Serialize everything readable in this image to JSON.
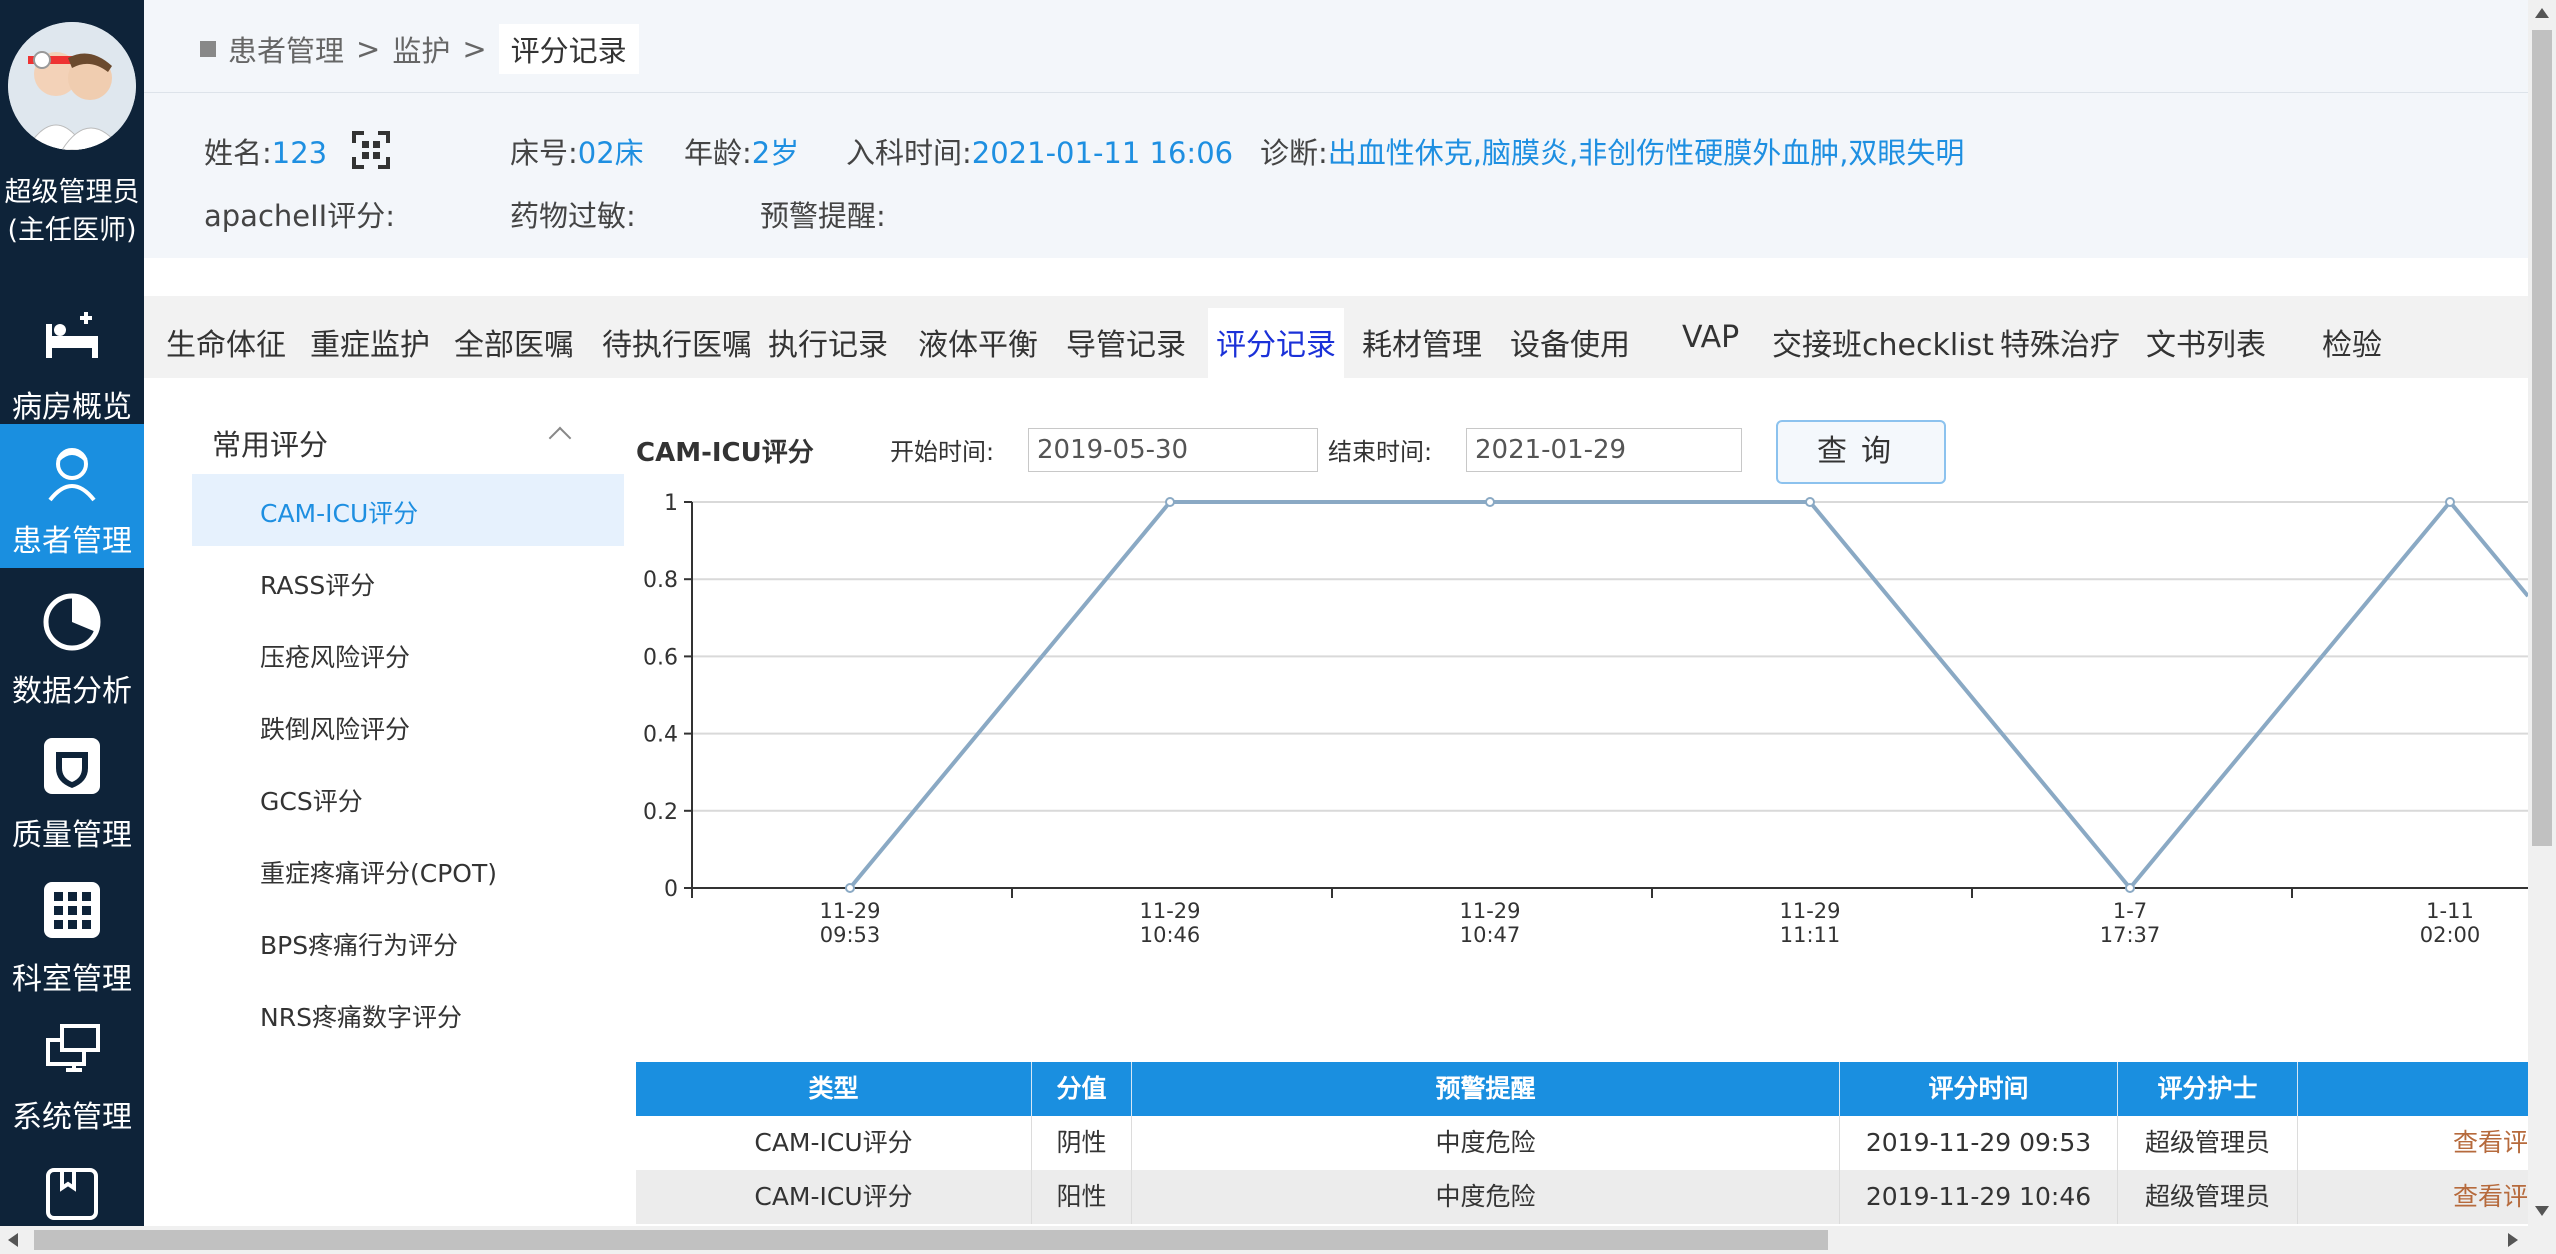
{
  "user": {
    "name": "超级管理员",
    "role": "(主任医师)"
  },
  "nav": [
    {
      "label": "病房概览",
      "icon": "bed-icon"
    },
    {
      "label": "患者管理",
      "icon": "patient-icon"
    },
    {
      "label": "数据分析",
      "icon": "pie-chart-icon"
    },
    {
      "label": "质量管理",
      "icon": "shield-icon"
    },
    {
      "label": "科室管理",
      "icon": "grid-icon"
    },
    {
      "label": "系统管理",
      "icon": "monitor-icon"
    },
    {
      "label": "",
      "icon": "archive-icon"
    }
  ],
  "breadcrumb": {
    "level1": "患者管理",
    "sep": ">",
    "level2": "监护",
    "current": "评分记录"
  },
  "patient": {
    "name_label": "姓名:",
    "name": "123",
    "bed_label": "床号:",
    "bed": "02床",
    "age_label": "年龄:",
    "age": "2岁",
    "admit_label": "入科时间:",
    "admit": "2021-01-11 16:06",
    "diag_label": "诊断:",
    "diag": "出血性休克,脑膜炎,非创伤性硬膜外血肿,双眼失明",
    "apache_label": "apacheII评分:",
    "allergy_label": "药物过敏:",
    "alert_label": "预警提醒:"
  },
  "tabs": [
    "生命体征",
    "重症监护",
    "全部医嘱",
    "待执行医嘱",
    "执行记录",
    "液体平衡",
    "导管记录",
    "评分记录",
    "耗材管理",
    "设备使用",
    "VAP",
    "交接班checklist",
    "特殊治疗",
    "文书列表",
    "检验"
  ],
  "menu": {
    "group": "常用评分",
    "items": [
      "CAM-ICU评分",
      "RASS评分",
      "压疮风险评分",
      "跌倒风险评分",
      "GCS评分",
      "重症疼痛评分(CPOT)",
      "BPS疼痛行为评分",
      "NRS疼痛数字评分"
    ]
  },
  "query": {
    "title": "CAM-ICU评分",
    "start_label": "开始时间:",
    "start": "2019-05-30",
    "end_label": "结束时间:",
    "end": "2021-01-29",
    "button": "查询"
  },
  "chart_data": {
    "type": "line",
    "categories": [
      [
        "11-29",
        "09:53"
      ],
      [
        "11-29",
        "10:46"
      ],
      [
        "11-29",
        "10:47"
      ],
      [
        "11-29",
        "11:11"
      ],
      [
        "1-7",
        "17:37"
      ],
      [
        "1-11",
        "02:00"
      ]
    ],
    "values": [
      0,
      1,
      1,
      1,
      0,
      1
    ],
    "y_ticks": [
      "0",
      "0.2",
      "0.4",
      "0.6",
      "0.8",
      "1"
    ],
    "ylim": [
      0,
      1
    ],
    "grid": true,
    "line_color": "#8aa9c4"
  },
  "table": {
    "headers": [
      "类型",
      "分值",
      "预警提醒",
      "评分时间",
      "评分护士",
      ""
    ],
    "rows": [
      [
        "CAM-ICU评分",
        "阴性",
        "中度危险",
        "2019-11-29 09:53",
        "超级管理员",
        "查看评"
      ],
      [
        "CAM-ICU评分",
        "阳性",
        "中度危险",
        "2019-11-29 10:46",
        "超级管理员",
        "查看评"
      ]
    ]
  },
  "colors": {
    "sidebar": "#0e2339",
    "accent": "#1a8fe0",
    "active_tab": "#1b31d8"
  }
}
